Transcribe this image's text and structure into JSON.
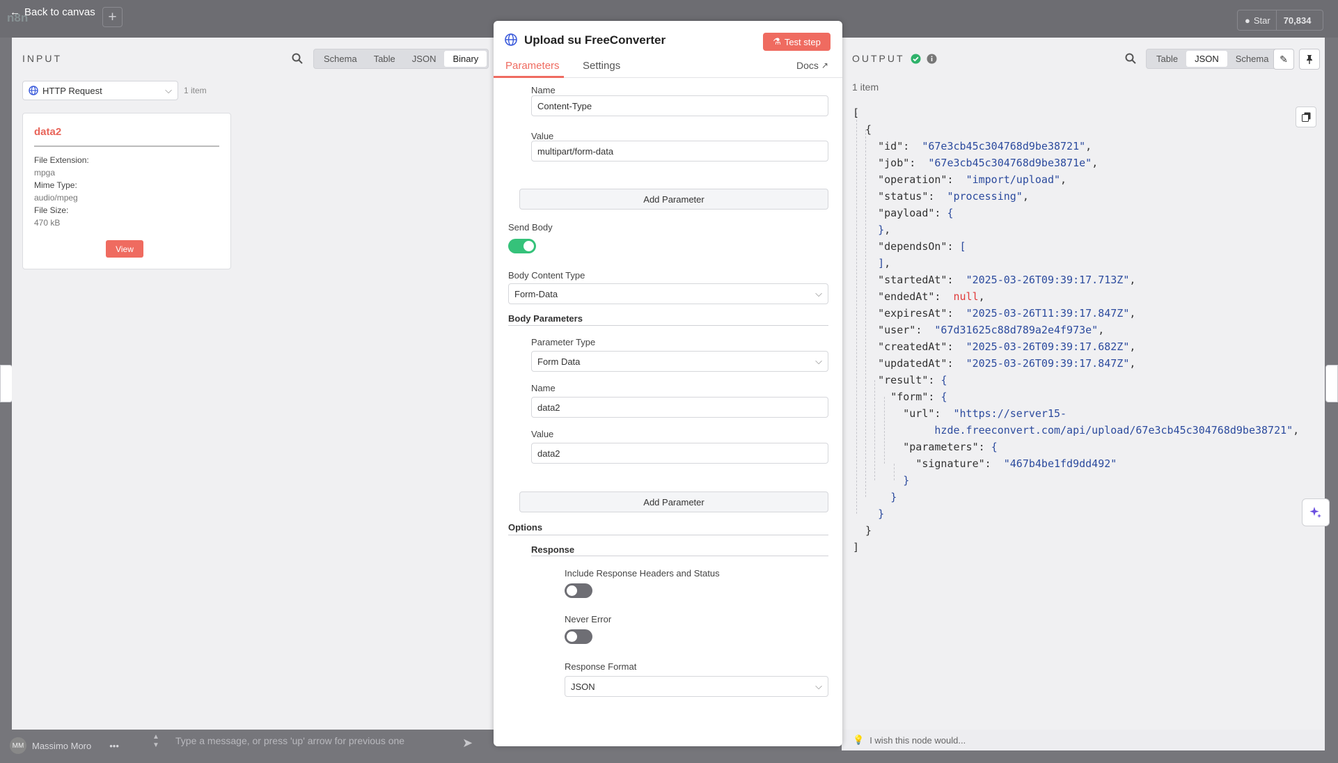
{
  "app": {
    "back_label": "Back to canvas",
    "logo_text": "n8n",
    "star_label": "Star",
    "star_count": "70,834"
  },
  "bottom": {
    "user_initials": "MM",
    "user_name": "Massimo Moro",
    "more": "•••",
    "chat_placeholder": "Type a message, or press 'up' arrow for previous one"
  },
  "input": {
    "title": "INPUT",
    "tabs": [
      "Schema",
      "Table",
      "JSON",
      "Binary"
    ],
    "active_tab": "Binary",
    "node": "HTTP Request",
    "item_count": "1 item",
    "binary": {
      "name": "data2",
      "k1": "File Extension:",
      "v1": "mpga",
      "k2": "Mime Type:",
      "v2": "audio/mpeg",
      "k3": "File Size:",
      "v3": "470 kB",
      "view": "View"
    }
  },
  "center": {
    "title": "Upload su FreeConverter",
    "test_step": "Test step",
    "tab_params": "Parameters",
    "tab_settings": "Settings",
    "docs": "Docs",
    "h_name_label": "Name",
    "h_name_value": "Content-Type",
    "h_value_label": "Value",
    "h_value_value": "multipart/form-data",
    "add_param": "Add Parameter",
    "send_body": "Send Body",
    "body_content_type_label": "Body Content Type",
    "body_content_type": "Form-Data",
    "body_params": "Body Parameters",
    "param_type_label": "Parameter Type",
    "param_type": "Form Data",
    "b_name_label": "Name",
    "b_name_value": "data2",
    "b_value_label": "Value",
    "b_value_value": "data2",
    "options": "Options",
    "response": "Response",
    "incl_headers": "Include Response Headers and Status",
    "never_error": "Never Error",
    "resp_format_label": "Response Format",
    "resp_format": "JSON"
  },
  "output": {
    "title": "OUTPUT",
    "tabs": [
      "Table",
      "JSON",
      "Schema"
    ],
    "active_tab": "JSON",
    "item_count": "1 item",
    "feedback": "I wish this node would...",
    "json": {
      "id": "\"67e3cb45c304768d9be38721\"",
      "job": "\"67e3cb45c304768d9be3871e\"",
      "operation": "\"import/upload\"",
      "status": "\"processing\"",
      "startedAt": "\"2025-03-26T09:39:17.713Z\"",
      "endedAt": "null",
      "expiresAt": "\"2025-03-26T11:39:17.847Z\"",
      "user": "\"67d31625c88d789a2e4f973e\"",
      "createdAt": "\"2025-03-26T09:39:17.682Z\"",
      "updatedAt": "\"2025-03-26T09:39:17.847Z\"",
      "url_1": "\"https://server15-",
      "url_2": "hzde.freeconvert.com/api/upload/67e3cb45c304768d9be38721\"",
      "signature": "\"467b4be1fd9dd492\""
    }
  }
}
